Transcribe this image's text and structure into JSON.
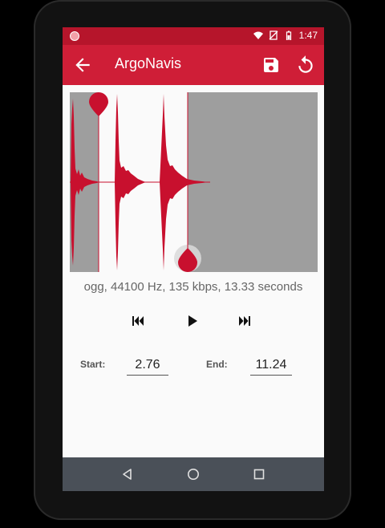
{
  "status_bar": {
    "time": "1:47",
    "icons": [
      "wifi-icon",
      "no-sim-icon",
      "battery-icon"
    ]
  },
  "app_bar": {
    "title": "ArgoNavis",
    "actions": [
      "save-icon",
      "reset-icon"
    ]
  },
  "audio": {
    "info": "ogg, 44100 Hz, 135 kbps, 13.33 seconds",
    "start_label": "Start:",
    "start_value": "2.76",
    "end_label": "End:",
    "end_value": "11.24"
  },
  "transport": {
    "buttons": [
      "skip-previous-icon",
      "play-icon",
      "skip-next-icon"
    ]
  },
  "nav_bar": {
    "buttons": [
      "back-nav-icon",
      "home-nav-icon",
      "recents-nav-icon"
    ]
  },
  "colors": {
    "status_bar": "#b6152b",
    "app_bar": "#cf1e37",
    "waveform": "#c8102e",
    "selection": "#9e9e9e",
    "nav_bar": "#4a5058"
  }
}
